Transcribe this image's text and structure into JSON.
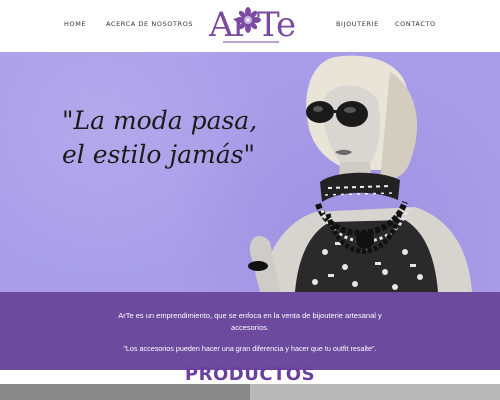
{
  "nav": {
    "home": "HOME",
    "about": "ACERCA DE NOSOTROS",
    "bijouterie": "BIJOUTERIE",
    "contact": "CONTACTO"
  },
  "logo": {
    "part1": "Ar",
    "part2": "Te"
  },
  "hero": {
    "quote_line1": "\"La moda pasa,",
    "quote_line2": "el estilo jamás\""
  },
  "band": {
    "intro": "ArTe es un emprendimiento, que se enfoca en la venta de bijouterie artesanal y accesorios.",
    "motto": "\"Los accesorios pueden hacer una gran diferencia y hacer que tu outfit resalte\"."
  },
  "products": {
    "title": "PRODUCTOS"
  },
  "colors": {
    "brand_purple": "#6c4a9e",
    "hero_lavender": "#a99de9",
    "title_purple": "#6b3fa0"
  }
}
